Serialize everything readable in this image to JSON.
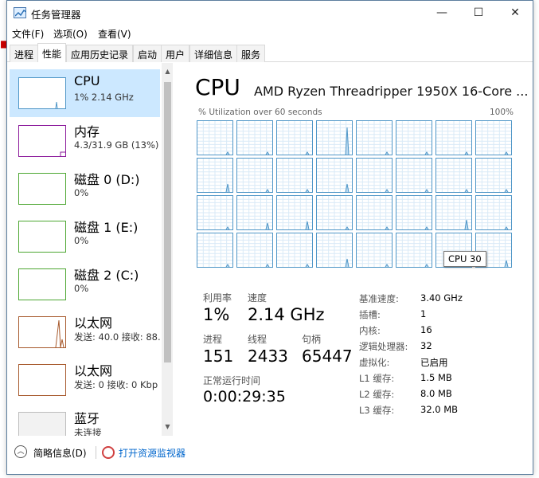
{
  "window": {
    "title": "任务管理器"
  },
  "menu": [
    "文件(F)",
    "选项(O)",
    "查看(V)"
  ],
  "tabs": [
    "进程",
    "性能",
    "应用历史记录",
    "启动",
    "用户",
    "详细信息",
    "服务"
  ],
  "active_tab": "性能",
  "sidebar": {
    "items": [
      {
        "title": "CPU",
        "sub": "1% 2.14 GHz",
        "color": "#4f96c7",
        "selected": true
      },
      {
        "title": "内存",
        "sub": "4.3/31.9 GB (13%)",
        "color": "#8b1a9b",
        "selected": false
      },
      {
        "title": "磁盘 0 (D:)",
        "sub": "0%",
        "color": "#4da732",
        "selected": false
      },
      {
        "title": "磁盘 1 (E:)",
        "sub": "0%",
        "color": "#4da732",
        "selected": false
      },
      {
        "title": "磁盘 2 (C:)",
        "sub": "0%",
        "color": "#4da732",
        "selected": false
      },
      {
        "title": "以太网",
        "sub": "发送: 40.0 接收: 88.",
        "color": "#a7592c",
        "selected": false
      },
      {
        "title": "以太网",
        "sub": "发送: 0 接收: 0 Kbp",
        "color": "#a7592c",
        "selected": false
      },
      {
        "title": "蓝牙",
        "sub": "未连接",
        "color": "#bdbdbd",
        "selected": false
      }
    ]
  },
  "main": {
    "heading": "CPU",
    "cpu_name": "AMD Ryzen Threadripper 1950X 16-Core ...",
    "util_label": "% Utilization over 60 seconds",
    "util_max": "100%",
    "tooltip": "CPU 30",
    "stats": {
      "util_label": "利用率",
      "util_value": "1%",
      "speed_label": "速度",
      "speed_value": "2.14 GHz",
      "proc_label": "进程",
      "proc_value": "151",
      "thread_label": "线程",
      "thread_value": "2433",
      "handle_label": "句柄",
      "handle_value": "65447",
      "uptime_label": "正常运行时间",
      "uptime_value": "0:00:29:35"
    },
    "specs": [
      {
        "label": "基准速度:",
        "value": "3.40 GHz"
      },
      {
        "label": "插槽:",
        "value": "1"
      },
      {
        "label": "内核:",
        "value": "16"
      },
      {
        "label": "逻辑处理器:",
        "value": "32"
      },
      {
        "label": "虚拟化:",
        "value": "已启用"
      },
      {
        "label": "L1 缓存:",
        "value": "1.5 MB"
      },
      {
        "label": "L2 缓存:",
        "value": "8.0 MB"
      },
      {
        "label": "L3 缓存:",
        "value": "32.0 MB"
      }
    ]
  },
  "footer": {
    "fewer": "简略信息(D)",
    "monitor": "打开资源监视器"
  },
  "colors": {
    "cpu": "#4f96c7",
    "grid": "#d9eaf7",
    "selected_bg": "#cce8ff"
  }
}
